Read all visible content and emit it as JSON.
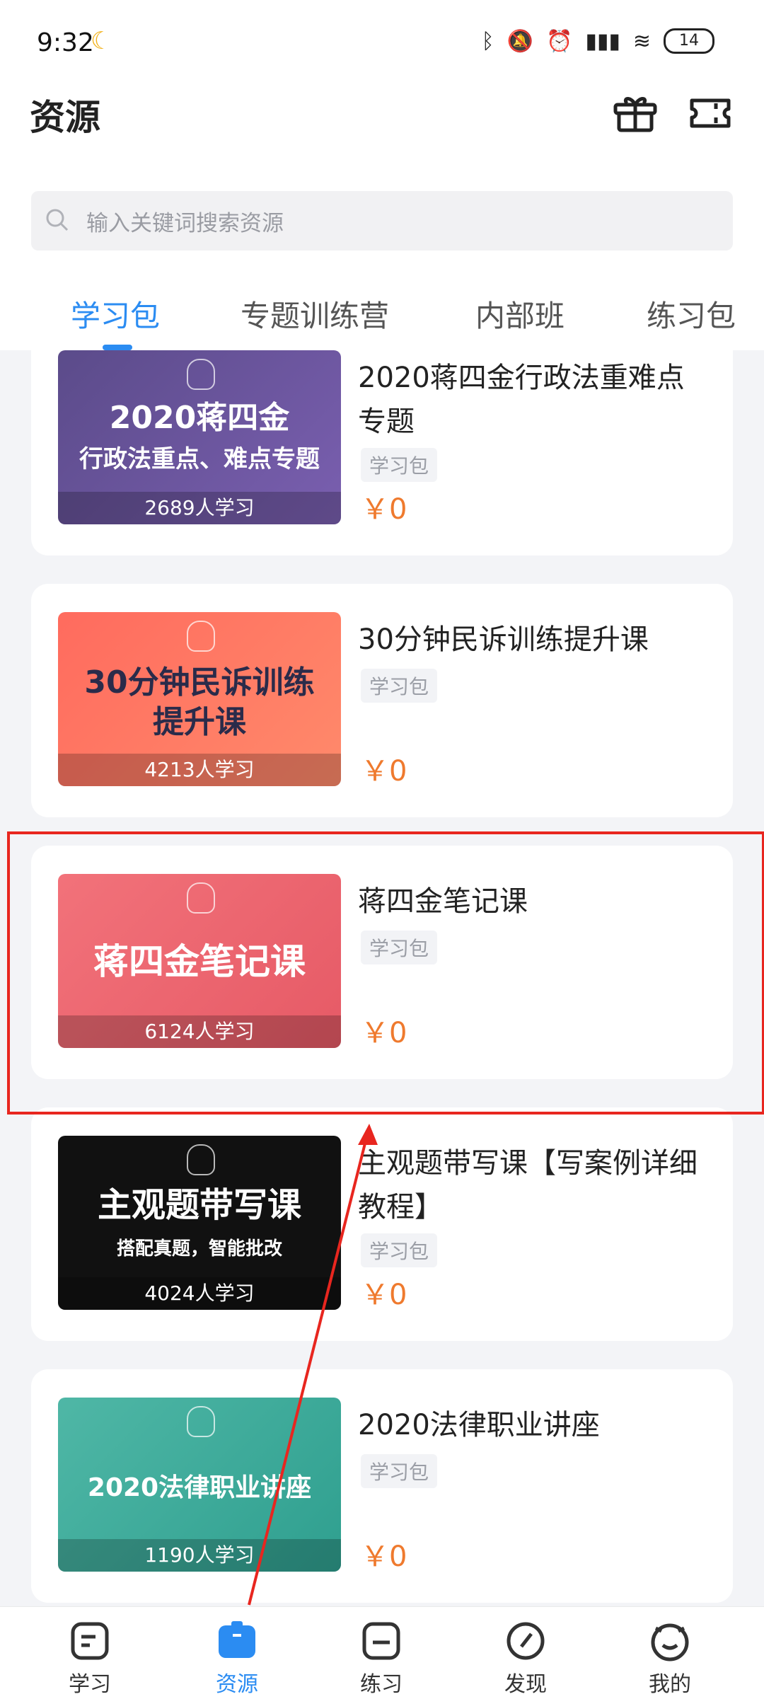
{
  "status_bar": {
    "time": "9:32",
    "battery": "14"
  },
  "header": {
    "title": "资源",
    "gift_icon": "gift-icon",
    "ticket_icon": "ticket-icon"
  },
  "search": {
    "placeholder": "输入关键词搜索资源"
  },
  "tabs": [
    {
      "label": "学习包",
      "active": true
    },
    {
      "label": "专题训练营"
    },
    {
      "label": "内部班"
    },
    {
      "label": "练习包"
    }
  ],
  "cards": [
    {
      "title": "2020蒋四金行政法重难点专题",
      "tag": "学习包",
      "price": "￥0",
      "thumb_line1": "2020蒋四金",
      "thumb_line2": "行政法重点、难点专题",
      "learners": "2689人学习"
    },
    {
      "title": "30分钟民诉训练提升课",
      "tag": "学习包",
      "price": "￥0",
      "thumb_line1": "30分钟民诉训练",
      "thumb_line2": "提升课",
      "learners": "4213人学习"
    },
    {
      "title": "蒋四金笔记课",
      "tag": "学习包",
      "price": "￥0",
      "thumb_line1": "蒋四金笔记课",
      "thumb_line2": "",
      "learners": "6124人学习"
    },
    {
      "title": "主观题带写课【写案例详细教程】",
      "tag": "学习包",
      "price": "￥0",
      "thumb_line1": "主观题带写课",
      "thumb_line2": "搭配真题，智能批改",
      "learners": "4024人学习"
    },
    {
      "title": "2020法律职业讲座",
      "tag": "学习包",
      "price": "￥0",
      "thumb_line1": "2020法律职业讲座",
      "thumb_line2": "",
      "learners": "1190人学习"
    }
  ],
  "bottom_nav": [
    {
      "label": "学习",
      "icon": "study-icon"
    },
    {
      "label": "资源",
      "icon": "resource-icon",
      "active": true
    },
    {
      "label": "练习",
      "icon": "practice-icon"
    },
    {
      "label": "发现",
      "icon": "compass-icon"
    },
    {
      "label": "我的",
      "icon": "profile-icon"
    }
  ],
  "colors": {
    "accent": "#2b8cf2",
    "price": "#ef7a2e",
    "highlight_box": "#e8261f"
  }
}
